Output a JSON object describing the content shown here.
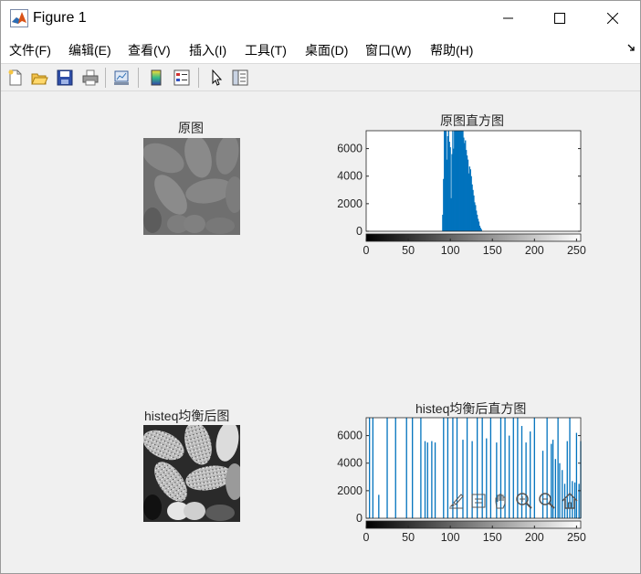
{
  "window": {
    "title": "Figure 1",
    "controls": {
      "minimize": "—",
      "maximize": "☐",
      "close": "✕"
    }
  },
  "menu": {
    "items": [
      {
        "label": "文件(F)"
      },
      {
        "label": "编辑(E)"
      },
      {
        "label": "查看(V)"
      },
      {
        "label": "插入(I)"
      },
      {
        "label": "工具(T)"
      },
      {
        "label": "桌面(D)"
      },
      {
        "label": "窗口(W)"
      },
      {
        "label": "帮助(H)"
      }
    ],
    "expand_icon": "dock-arrow-icon"
  },
  "toolbar": {
    "icons": [
      "new-figure-icon",
      "open-file-icon",
      "save-icon",
      "print-icon",
      "link-plot-icon",
      "insert-colorbar-icon",
      "insert-legend-icon",
      "edit-plot-cursor-icon",
      "property-inspector-icon"
    ]
  },
  "axes_toolbar": {
    "icons": [
      "brush-icon",
      "datatip-icon",
      "pan-hand-icon",
      "zoom-in-icon",
      "zoom-out-icon",
      "restore-view-icon"
    ]
  },
  "subplots": {
    "original_image": {
      "title": "原图"
    },
    "equalized_image": {
      "title": "histeq均衡后图"
    }
  },
  "chart_data": [
    {
      "type": "bar",
      "title": "原图直方图",
      "xlabel": "",
      "ylabel": "",
      "xlim": [
        0,
        255
      ],
      "ylim": [
        0,
        7300
      ],
      "xticks": [
        0,
        50,
        100,
        150,
        200,
        250
      ],
      "yticks": [
        0,
        2000,
        4000,
        6000
      ],
      "colorbar": "gray",
      "bar_color": "#0072bd",
      "x": [
        91,
        92,
        93,
        94,
        95,
        96,
        97,
        98,
        99,
        100,
        101,
        102,
        103,
        104,
        105,
        106,
        107,
        108,
        109,
        110,
        111,
        112,
        113,
        114,
        115,
        116,
        117,
        118,
        119,
        120,
        121,
        122,
        123,
        124,
        125,
        126,
        127,
        128,
        129,
        130,
        131,
        132,
        133,
        134,
        135,
        136,
        137
      ],
      "values": [
        1200,
        3800,
        7300,
        7300,
        7300,
        5200,
        6900,
        7300,
        6500,
        6100,
        2400,
        5600,
        7300,
        6000,
        7300,
        7300,
        7300,
        7300,
        7300,
        7300,
        7300,
        7300,
        7300,
        7300,
        7300,
        6800,
        6400,
        6600,
        5900,
        5500,
        5200,
        4200,
        4700,
        4500,
        4000,
        3400,
        3000,
        2600,
        2100,
        1900,
        1500,
        1200,
        900,
        700,
        400,
        250,
        150
      ]
    },
    {
      "type": "bar",
      "title": "histeq均衡后直方图",
      "xlabel": "",
      "ylabel": "",
      "xlim": [
        0,
        255
      ],
      "ylim": [
        0,
        7300
      ],
      "xticks": [
        0,
        50,
        100,
        150,
        200,
        250
      ],
      "yticks": [
        0,
        2000,
        4000,
        6000
      ],
      "colorbar": "gray",
      "bar_color": "#0072bd",
      "x": [
        4,
        8,
        15,
        25,
        35,
        48,
        55,
        65,
        70,
        73,
        78,
        82,
        92,
        97,
        103,
        108,
        115,
        120,
        126,
        132,
        138,
        143,
        148,
        155,
        160,
        165,
        170,
        175,
        180,
        185,
        190,
        195,
        200,
        210,
        215,
        220,
        222,
        225,
        228,
        230,
        233,
        236,
        239,
        242,
        245,
        248,
        250,
        253,
        255
      ],
      "values": [
        7300,
        7300,
        1700,
        7300,
        7300,
        7300,
        7300,
        7300,
        5600,
        5500,
        5600,
        5500,
        7300,
        7300,
        7300,
        7300,
        5700,
        7300,
        5600,
        7300,
        7300,
        5800,
        7300,
        5500,
        7300,
        7300,
        6000,
        7300,
        7300,
        6700,
        5500,
        6300,
        7300,
        4900,
        7300,
        5400,
        5700,
        4300,
        7300,
        4000,
        3500,
        2500,
        5600,
        7300,
        2700,
        2600,
        6200,
        2500,
        5600
      ]
    }
  ]
}
